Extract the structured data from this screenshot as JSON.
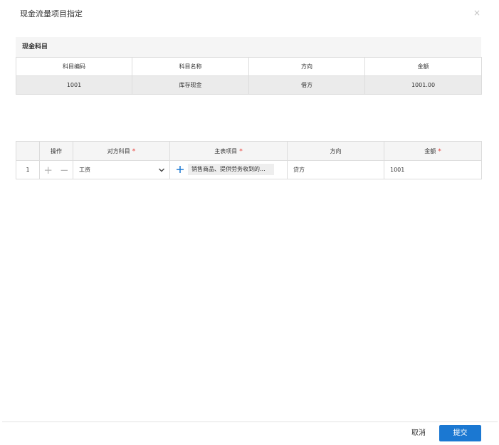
{
  "dialog": {
    "title": "现金流量项目指定",
    "close_label": "×"
  },
  "cash_section": {
    "header": "现金科目",
    "columns": [
      "科目编码",
      "科目名称",
      "方向",
      "金额"
    ],
    "row": {
      "code": "1001",
      "name": "库存现金",
      "direction": "借方",
      "amount": "1001.00"
    }
  },
  "flow_table": {
    "columns": {
      "index": "",
      "operation": "操作",
      "counter_account": "对方科目",
      "main_item": "主表项目",
      "direction": "方向",
      "amount": "金额"
    },
    "required_mark": "*",
    "add_icon": "+",
    "remove_icon": "−",
    "rows": [
      {
        "index": "1",
        "counter_account": "工资",
        "main_item": "销售商品、提供劳务收到的...",
        "direction": "贷方",
        "amount": "1001"
      }
    ]
  },
  "footer": {
    "cancel_label": "取消",
    "submit_label": "提交"
  },
  "colors": {
    "primary": "#1b78d2",
    "required": "#e8352f"
  }
}
